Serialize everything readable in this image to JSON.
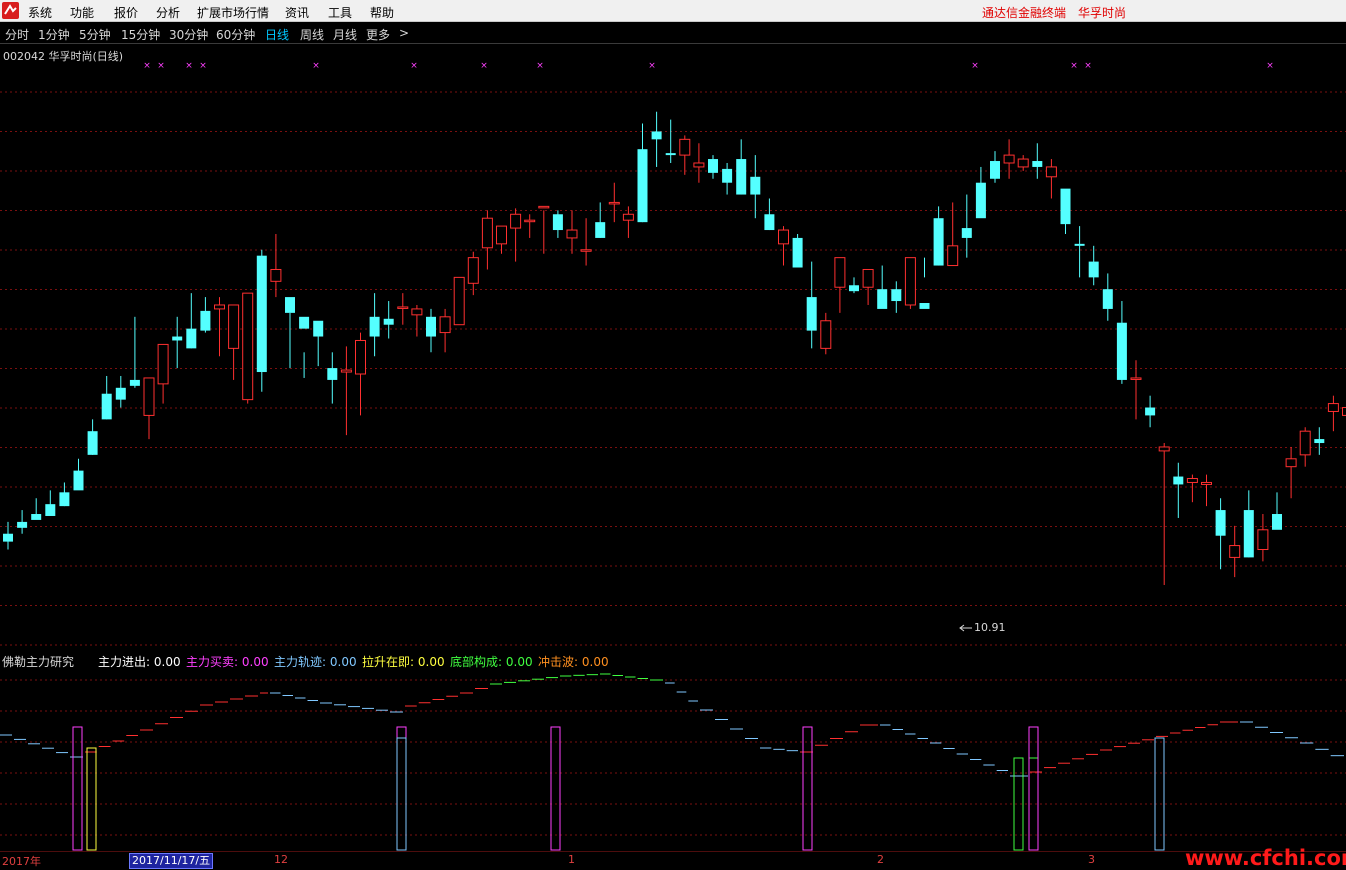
{
  "menu": {
    "items": [
      "系统",
      "功能",
      "报价",
      "分析",
      "扩展市场行情",
      "资讯",
      "工具",
      "帮助"
    ],
    "brand": "通达信金融终端",
    "stock_name": "华孚时尚"
  },
  "periods": {
    "items": [
      "分时",
      "1分钟",
      "5分钟",
      "15分钟",
      "30分钟",
      "60分钟",
      "日线",
      "周线",
      "月线",
      "更多",
      ">"
    ],
    "active": "日线"
  },
  "main": {
    "title": "002042 华孚时尚(日线)",
    "low_label": "10.91"
  },
  "indicator": {
    "name": "佛勒主力研究",
    "items": [
      {
        "label": "主力进出:",
        "value": "0.00",
        "color": "#ffffff"
      },
      {
        "label": "主力买卖:",
        "value": "0.00",
        "color": "#ff40ff"
      },
      {
        "label": "主力轨迹:",
        "value": "0.00",
        "color": "#80c8ff"
      },
      {
        "label": "拉升在即:",
        "value": "0.00",
        "color": "#ffff40"
      },
      {
        "label": "底部构成:",
        "value": "0.00",
        "color": "#40ff40"
      },
      {
        "label": "冲击波:",
        "value": "0.00",
        "color": "#ff9020"
      }
    ]
  },
  "axis": {
    "labels": [
      "2017年",
      "12",
      "1",
      "2",
      "3"
    ],
    "cursor_date": "2017/11/17/五"
  },
  "watermark": "www.cfchi.com",
  "colors": {
    "up": "#ff3030",
    "down": "#54ffff",
    "grid": "#7a1010",
    "magenta": "#ff40ff"
  },
  "chart_data": {
    "type": "candlestick",
    "series": [
      {
        "values": [
          [
            13.3,
            13.6,
            12.9,
            13.1
          ],
          [
            13.6,
            13.9,
            13.3,
            13.45
          ],
          [
            13.8,
            14.2,
            13.7,
            13.65
          ],
          [
            14.05,
            14.4,
            13.85,
            13.75
          ],
          [
            14.35,
            14.6,
            14.0,
            14.0
          ],
          [
            14.9,
            15.2,
            14.45,
            14.4
          ],
          [
            15.9,
            16.2,
            15.3,
            15.3
          ],
          [
            16.85,
            17.3,
            16.2,
            16.2
          ],
          [
            17.0,
            17.3,
            16.5,
            16.7
          ],
          [
            17.2,
            18.8,
            17.0,
            17.05
          ],
          [
            16.3,
            17.25,
            15.7,
            17.25
          ],
          [
            17.1,
            18.1,
            16.6,
            18.1
          ],
          [
            18.3,
            18.8,
            17.5,
            18.2
          ],
          [
            18.5,
            19.4,
            18.0,
            18.0
          ],
          [
            18.95,
            19.3,
            18.4,
            18.45
          ],
          [
            19.0,
            19.3,
            17.8,
            19.1
          ],
          [
            18.0,
            19.1,
            17.2,
            19.1
          ],
          [
            16.7,
            19.4,
            16.6,
            19.4
          ],
          [
            20.35,
            20.5,
            16.9,
            17.4
          ],
          [
            19.7,
            20.9,
            19.3,
            20.0
          ],
          [
            19.3,
            18.9,
            17.5,
            18.9
          ],
          [
            18.8,
            17.9,
            17.25,
            18.5
          ],
          [
            18.7,
            18.3,
            17.55,
            18.3
          ],
          [
            17.5,
            17.9,
            16.6,
            17.2
          ],
          [
            17.4,
            18.05,
            15.8,
            17.45
          ],
          [
            17.35,
            18.4,
            16.3,
            18.2
          ],
          [
            18.8,
            19.4,
            17.8,
            18.3
          ],
          [
            18.75,
            19.2,
            18.25,
            18.6
          ],
          [
            19.05,
            19.4,
            18.6,
            19.05
          ],
          [
            18.85,
            19.1,
            18.3,
            19.0
          ],
          [
            18.8,
            19.0,
            17.9,
            18.3
          ],
          [
            18.4,
            19.0,
            17.9,
            18.8
          ],
          [
            18.6,
            19.8,
            18.6,
            19.8
          ],
          [
            19.65,
            20.45,
            19.35,
            20.3
          ],
          [
            20.55,
            21.5,
            20.0,
            21.3
          ],
          [
            20.65,
            21.0,
            20.4,
            21.1
          ],
          [
            21.05,
            21.55,
            20.2,
            21.4
          ],
          [
            21.25,
            21.4,
            20.8,
            21.25
          ],
          [
            21.6,
            21.5,
            20.4,
            21.6
          ],
          [
            21.4,
            21.5,
            20.8,
            21.0
          ],
          [
            20.8,
            21.5,
            20.4,
            21.0
          ],
          [
            20.5,
            21.3,
            20.1,
            20.5
          ],
          [
            21.2,
            21.7,
            20.8,
            20.8
          ],
          [
            21.7,
            22.2,
            21.2,
            21.7
          ],
          [
            21.25,
            21.6,
            20.8,
            21.4
          ],
          [
            23.05,
            23.7,
            21.2,
            21.2
          ],
          [
            23.5,
            24.0,
            22.6,
            23.3
          ],
          [
            22.95,
            23.8,
            22.7,
            22.9
          ],
          [
            22.9,
            23.4,
            22.4,
            23.3
          ],
          [
            22.6,
            23.2,
            22.2,
            22.7
          ],
          [
            22.8,
            22.9,
            22.3,
            22.45
          ],
          [
            22.55,
            22.7,
            21.9,
            22.2
          ],
          [
            22.8,
            23.3,
            21.9,
            21.9
          ],
          [
            22.35,
            22.9,
            21.3,
            21.9
          ],
          [
            21.4,
            21.8,
            21.0,
            21.0
          ],
          [
            20.65,
            21.1,
            20.1,
            21.0
          ],
          [
            20.8,
            20.9,
            20.1,
            20.05
          ],
          [
            19.3,
            20.2,
            18.0,
            18.45
          ],
          [
            18.0,
            18.9,
            17.85,
            18.7
          ],
          [
            19.55,
            20.3,
            18.9,
            20.3
          ],
          [
            19.6,
            19.8,
            19.4,
            19.45
          ],
          [
            19.55,
            20.0,
            19.1,
            20.0
          ],
          [
            19.5,
            20.1,
            19.1,
            19.0
          ],
          [
            19.5,
            19.7,
            18.9,
            19.2
          ],
          [
            19.1,
            20.1,
            19.0,
            20.3
          ],
          [
            19.15,
            20.3,
            19.8,
            19.0
          ],
          [
            21.3,
            21.6,
            20.1,
            20.1
          ],
          [
            20.1,
            21.7,
            20.6,
            20.6
          ],
          [
            21.05,
            21.9,
            20.3,
            20.8
          ],
          [
            22.2,
            22.6,
            21.5,
            21.3
          ],
          [
            22.75,
            23.0,
            22.2,
            22.3
          ],
          [
            22.7,
            23.3,
            22.3,
            22.9
          ],
          [
            22.6,
            22.9,
            22.5,
            22.8
          ],
          [
            22.75,
            23.2,
            22.3,
            22.6
          ],
          [
            22.35,
            22.8,
            21.8,
            22.6
          ],
          [
            22.05,
            21.8,
            20.9,
            21.15
          ],
          [
            20.65,
            21.1,
            19.8,
            20.6
          ],
          [
            20.2,
            20.6,
            19.6,
            19.8
          ],
          [
            19.5,
            19.9,
            18.7,
            19.0
          ],
          [
            18.65,
            19.2,
            17.1,
            17.2
          ],
          [
            17.25,
            17.7,
            16.2,
            17.25
          ],
          [
            16.5,
            16.8,
            16.0,
            16.3
          ],
          [
            15.4,
            15.6,
            12.0,
            15.5
          ],
          [
            14.75,
            15.1,
            13.7,
            14.55
          ],
          [
            14.6,
            14.8,
            14.1,
            14.7
          ],
          [
            14.55,
            14.8,
            14.0,
            14.6
          ],
          [
            13.9,
            14.2,
            12.4,
            13.25
          ],
          [
            12.7,
            13.5,
            12.2,
            13.0
          ],
          [
            13.9,
            14.4,
            12.7,
            12.7
          ],
          [
            12.9,
            13.8,
            12.6,
            13.4
          ],
          [
            13.8,
            14.35,
            13.5,
            13.4
          ],
          [
            15.0,
            15.5,
            14.2,
            15.2
          ],
          [
            15.3,
            16.0,
            15.0,
            15.9
          ],
          [
            15.7,
            16.0,
            15.3,
            15.6
          ],
          [
            16.4,
            16.8,
            15.9,
            16.6
          ],
          [
            16.3,
            16.9,
            15.9,
            16.5
          ],
          [
            16.9,
            17.2,
            16.2,
            17.1
          ],
          [
            17.45,
            17.9,
            16.3,
            16.7
          ],
          [
            17.5,
            17.7,
            16.8,
            17.3
          ],
          [
            17.5,
            17.9,
            16.9,
            17.0
          ]
        ]
      }
    ],
    "ohlc_order": [
      "open",
      "high",
      "low",
      "close"
    ],
    "price_range": [
      10.91,
      24.5
    ],
    "low_marker": 10.91
  }
}
